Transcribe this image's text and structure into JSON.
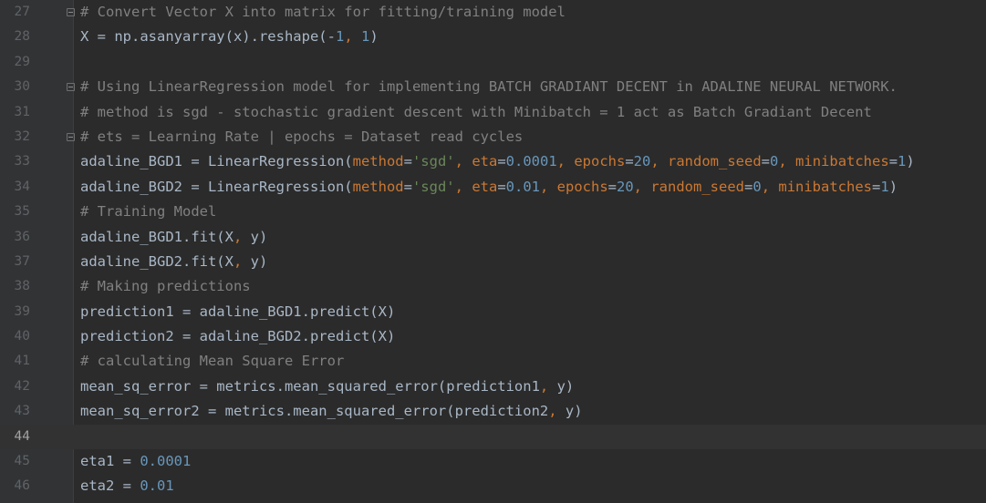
{
  "editor": {
    "colors": {
      "background": "#2b2b2b",
      "gutter": "#313335",
      "comment": "#808080",
      "keyword_arg": "#cc7832",
      "number": "#6897bb",
      "string": "#6a8759",
      "text": "#a9b7c6"
    },
    "current_line": 44,
    "lines": [
      {
        "n": "27",
        "fold": true,
        "tokens": [
          [
            "cm",
            "# Convert Vector X into matrix for fitting/training model"
          ]
        ]
      },
      {
        "n": "28",
        "fold": false,
        "tokens": [
          [
            "plain",
            "X = np.asanyarray(x).reshape(-"
          ],
          [
            "num",
            "1"
          ],
          [
            "pn",
            ", "
          ],
          [
            "num",
            "1"
          ],
          [
            "plain",
            ")"
          ]
        ]
      },
      {
        "n": "29",
        "fold": false,
        "tokens": []
      },
      {
        "n": "30",
        "fold": true,
        "tokens": [
          [
            "cm",
            "# Using LinearRegression model for implementing BATCH GRADIANT DECENT in ADALINE NEURAL NETWORK."
          ]
        ]
      },
      {
        "n": "31",
        "fold": false,
        "tokens": [
          [
            "cm",
            "# method is sgd - stochastic gradient descent with Minibatch = 1 act as Batch Gradiant Decent"
          ]
        ]
      },
      {
        "n": "32",
        "fold": true,
        "tokens": [
          [
            "cm",
            "# ets = Learning Rate | epochs = Dataset read cycles"
          ]
        ]
      },
      {
        "n": "33",
        "fold": false,
        "tokens": [
          [
            "plain",
            "adaline_BGD1 = LinearRegression("
          ],
          [
            "kw",
            "method"
          ],
          [
            "plain",
            "="
          ],
          [
            "str",
            "'sgd'"
          ],
          [
            "pn",
            ", "
          ],
          [
            "kw",
            "eta"
          ],
          [
            "plain",
            "="
          ],
          [
            "num",
            "0.0001"
          ],
          [
            "pn",
            ", "
          ],
          [
            "kw",
            "epochs"
          ],
          [
            "plain",
            "="
          ],
          [
            "num",
            "20"
          ],
          [
            "pn",
            ", "
          ],
          [
            "kw",
            "random_seed"
          ],
          [
            "plain",
            "="
          ],
          [
            "num",
            "0"
          ],
          [
            "pn",
            ", "
          ],
          [
            "kw",
            "minibatches"
          ],
          [
            "plain",
            "="
          ],
          [
            "num",
            "1"
          ],
          [
            "plain",
            ")"
          ]
        ]
      },
      {
        "n": "34",
        "fold": false,
        "tokens": [
          [
            "plain",
            "adaline_BGD2 = LinearRegression("
          ],
          [
            "kw",
            "method"
          ],
          [
            "plain",
            "="
          ],
          [
            "str",
            "'sgd'"
          ],
          [
            "pn",
            ", "
          ],
          [
            "kw",
            "eta"
          ],
          [
            "plain",
            "="
          ],
          [
            "num",
            "0.01"
          ],
          [
            "pn",
            ", "
          ],
          [
            "kw",
            "epochs"
          ],
          [
            "plain",
            "="
          ],
          [
            "num",
            "20"
          ],
          [
            "pn",
            ", "
          ],
          [
            "kw",
            "random_seed"
          ],
          [
            "plain",
            "="
          ],
          [
            "num",
            "0"
          ],
          [
            "pn",
            ", "
          ],
          [
            "kw",
            "minibatches"
          ],
          [
            "plain",
            "="
          ],
          [
            "num",
            "1"
          ],
          [
            "plain",
            ")"
          ]
        ]
      },
      {
        "n": "35",
        "fold": false,
        "tokens": [
          [
            "cm",
            "# Training Model"
          ]
        ]
      },
      {
        "n": "36",
        "fold": false,
        "tokens": [
          [
            "plain",
            "adaline_BGD1.fit(X"
          ],
          [
            "pn",
            ", "
          ],
          [
            "plain",
            "y)"
          ]
        ]
      },
      {
        "n": "37",
        "fold": false,
        "tokens": [
          [
            "plain",
            "adaline_BGD2.fit(X"
          ],
          [
            "pn",
            ", "
          ],
          [
            "plain",
            "y)"
          ]
        ]
      },
      {
        "n": "38",
        "fold": false,
        "tokens": [
          [
            "cm",
            "# Making predictions"
          ]
        ]
      },
      {
        "n": "39",
        "fold": false,
        "tokens": [
          [
            "plain",
            "prediction1 = adaline_BGD1.predict(X)"
          ]
        ]
      },
      {
        "n": "40",
        "fold": false,
        "tokens": [
          [
            "plain",
            "prediction2 = adaline_BGD2.predict(X)"
          ]
        ]
      },
      {
        "n": "41",
        "fold": false,
        "tokens": [
          [
            "cm",
            "# calculating Mean Square Error"
          ]
        ]
      },
      {
        "n": "42",
        "fold": false,
        "tokens": [
          [
            "plain",
            "mean_sq_error = metrics.mean_squared_error(prediction1"
          ],
          [
            "pn",
            ", "
          ],
          [
            "plain",
            "y)"
          ]
        ]
      },
      {
        "n": "43",
        "fold": false,
        "tokens": [
          [
            "plain",
            "mean_sq_error2 = metrics.mean_squared_error(prediction2"
          ],
          [
            "pn",
            ", "
          ],
          [
            "plain",
            "y)"
          ]
        ]
      },
      {
        "n": "44",
        "fold": false,
        "tokens": []
      },
      {
        "n": "45",
        "fold": false,
        "tokens": [
          [
            "plain",
            "eta1 = "
          ],
          [
            "num",
            "0.0001"
          ]
        ]
      },
      {
        "n": "46",
        "fold": false,
        "tokens": [
          [
            "plain",
            "eta2 = "
          ],
          [
            "num",
            "0.01"
          ]
        ]
      }
    ]
  }
}
